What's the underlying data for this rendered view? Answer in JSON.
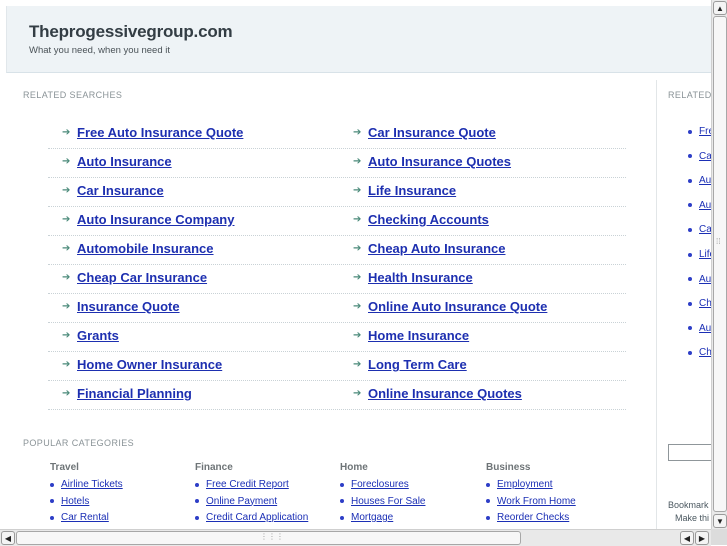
{
  "header": {
    "title": "Theprogessivegroup.com",
    "tagline": "What you need, when you need it"
  },
  "related": {
    "label": "RELATED SEARCHES",
    "left": [
      "Free Auto Insurance Quote",
      "Auto Insurance",
      "Car Insurance",
      "Auto Insurance Company",
      "Automobile Insurance",
      "Cheap Car Insurance",
      "Insurance Quote",
      "Grants",
      "Home Owner Insurance",
      "Financial Planning"
    ],
    "right": [
      "Car Insurance Quote",
      "Auto Insurance Quotes",
      "Life Insurance",
      "Checking Accounts",
      "Cheap Auto Insurance",
      "Health Insurance",
      "Online Auto Insurance Quote",
      "Home Insurance",
      "Long Term Care",
      "Online Insurance Quotes"
    ]
  },
  "popular": {
    "label": "POPULAR CATEGORIES",
    "categories": [
      {
        "name": "Travel",
        "links": [
          "Airline Tickets",
          "Hotels",
          "Car Rental"
        ]
      },
      {
        "name": "Finance",
        "links": [
          "Free Credit Report",
          "Online Payment",
          "Credit Card Application"
        ]
      },
      {
        "name": "Home",
        "links": [
          "Foreclosures",
          "Houses For Sale",
          "Mortgage"
        ]
      },
      {
        "name": "Business",
        "links": [
          "Employment",
          "Work From Home",
          "Reorder Checks"
        ]
      }
    ]
  },
  "sidebar": {
    "label": "RELATED",
    "links": [
      "Fre",
      "Ca",
      "Aut",
      "Au",
      "Ca",
      "Life",
      "Aut",
      "Ch",
      "Au",
      "Ch"
    ],
    "bookmark_line1": "Bookmark",
    "bookmark_line2": "Make thi"
  },
  "icons": {
    "arrow": "right-arrow-icon",
    "bullet": "bullet-icon"
  },
  "colors": {
    "link": "#1d2fb0",
    "header_bg": "#eef3f6",
    "arrow": "#4b8a7a"
  }
}
